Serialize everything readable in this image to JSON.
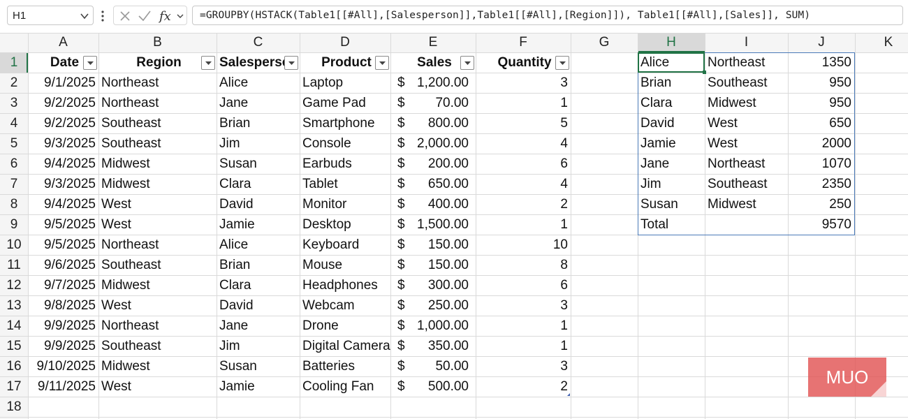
{
  "name_box": {
    "value": "H1"
  },
  "formula": {
    "text": "=GROUPBY(HSTACK(Table1[[#All],[Salesperson]],Table1[[#All],[Region]]), Table1[[#All],[Sales]], SUM)"
  },
  "icons": {
    "cancel": "x-icon",
    "enter": "check-icon",
    "function": "fx-icon"
  },
  "columns": [
    "A",
    "B",
    "C",
    "D",
    "E",
    "F",
    "G",
    "H",
    "I",
    "J",
    "K"
  ],
  "rows": [
    "1",
    "2",
    "3",
    "4",
    "5",
    "6",
    "7",
    "8",
    "9",
    "10",
    "11",
    "12",
    "13",
    "14",
    "15",
    "16",
    "17",
    "18"
  ],
  "table": {
    "headers": [
      "Date",
      "Region",
      "Salesperson",
      "Product",
      "Sales",
      "Quantity"
    ],
    "currency_symbol": "$",
    "rows": [
      [
        "9/1/2025",
        "Northeast",
        "Alice",
        "Laptop",
        "1,200.00",
        "3"
      ],
      [
        "9/2/2025",
        "Northeast",
        "Jane",
        "Game Pad",
        "70.00",
        "1"
      ],
      [
        "9/2/2025",
        "Southeast",
        "Brian",
        "Smartphone",
        "800.00",
        "5"
      ],
      [
        "9/3/2025",
        "Southeast",
        "Jim",
        "Console",
        "2,000.00",
        "4"
      ],
      [
        "9/4/2025",
        "Midwest",
        "Susan",
        "Earbuds",
        "200.00",
        "6"
      ],
      [
        "9/3/2025",
        "Midwest",
        "Clara",
        "Tablet",
        "650.00",
        "4"
      ],
      [
        "9/4/2025",
        "West",
        "David",
        "Monitor",
        "400.00",
        "2"
      ],
      [
        "9/5/2025",
        "West",
        "Jamie",
        "Desktop",
        "1,500.00",
        "1"
      ],
      [
        "9/5/2025",
        "Northeast",
        "Alice",
        "Keyboard",
        "150.00",
        "10"
      ],
      [
        "9/6/2025",
        "Southeast",
        "Brian",
        "Mouse",
        "150.00",
        "8"
      ],
      [
        "9/7/2025",
        "Midwest",
        "Clara",
        "Headphones",
        "300.00",
        "6"
      ],
      [
        "9/8/2025",
        "West",
        "David",
        "Webcam",
        "250.00",
        "3"
      ],
      [
        "9/9/2025",
        "Northeast",
        "Jane",
        "Drone",
        "1,000.00",
        "1"
      ],
      [
        "9/9/2025",
        "Southeast",
        "Jim",
        "Digital Camera",
        "350.00",
        "1"
      ],
      [
        "9/10/2025",
        "Midwest",
        "Susan",
        "Batteries",
        "50.00",
        "3"
      ],
      [
        "9/11/2025",
        "West",
        "Jamie",
        "Cooling Fan",
        "500.00",
        "2"
      ]
    ]
  },
  "result": {
    "rows": [
      [
        "Alice",
        "Northeast",
        "1350"
      ],
      [
        "Brian",
        "Southeast",
        "950"
      ],
      [
        "Clara",
        "Midwest",
        "950"
      ],
      [
        "David",
        "West",
        "650"
      ],
      [
        "Jamie",
        "West",
        "2000"
      ],
      [
        "Jane",
        "Northeast",
        "1070"
      ],
      [
        "Jim",
        "Southeast",
        "2350"
      ],
      [
        "Susan",
        "Midwest",
        "250"
      ],
      [
        "Total",
        "",
        "9570"
      ]
    ]
  },
  "watermark": {
    "text": "MUO",
    "color": "#e25454"
  },
  "colors": {
    "selection": "#217346",
    "header_bg": "#f5f5f5",
    "selected_header_bg": "#d9d9d9",
    "spill_border": "#4a7ab8"
  }
}
